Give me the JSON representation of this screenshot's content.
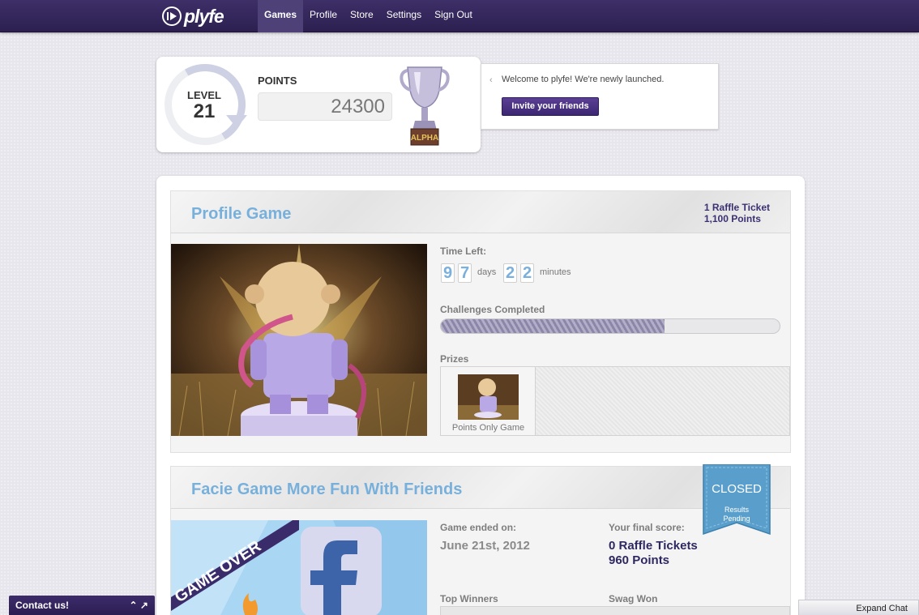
{
  "nav": {
    "logo_text": "plyfe",
    "links": [
      "Games",
      "Profile",
      "Store",
      "Settings",
      "Sign Out"
    ],
    "active": "Games"
  },
  "stats": {
    "level_label": "LEVEL",
    "level": "21",
    "points_label": "POINTS",
    "points": "24300",
    "badge_text": "ALPHA"
  },
  "welcome": {
    "message": "Welcome to plyfe! We're newly launched.",
    "invite_label": "Invite your friends"
  },
  "games": [
    {
      "title": "Profile Game",
      "reward_tickets": "1 Raffle Ticket",
      "reward_points": "1,100 Points",
      "time_left_label": "Time Left:",
      "days_digits": [
        "9",
        "7"
      ],
      "days_unit": "days",
      "minutes_digits": [
        "2",
        "2"
      ],
      "minutes_unit": "minutes",
      "challenges_label": "Challenges Completed",
      "challenges_progress": 0.66,
      "prizes_label": "Prizes",
      "prize_caption": "Points Only Game"
    },
    {
      "title": "Facie Game More Fun With Friends",
      "banner_text": "GAME OVER",
      "status": "CLOSED",
      "status_sub_1": "Results",
      "status_sub_2": "Pending",
      "ended_label": "Game ended on:",
      "ended_date": "June 21st, 2012",
      "final_score_label": "Your final score:",
      "final_tickets": "0 Raffle Tickets",
      "final_points": "960 Points",
      "top_winners_label": "Top Winners",
      "swag_won_label": "Swag Won"
    }
  ],
  "footer": {
    "contact_label": "Contact us!",
    "chat_label": "Expand Chat"
  },
  "colors": {
    "nav_bg": "#3e2f68",
    "title_blue": "#78b0dc",
    "accent_purple": "#3b3172",
    "closed_blue": "#5a9fcb"
  }
}
